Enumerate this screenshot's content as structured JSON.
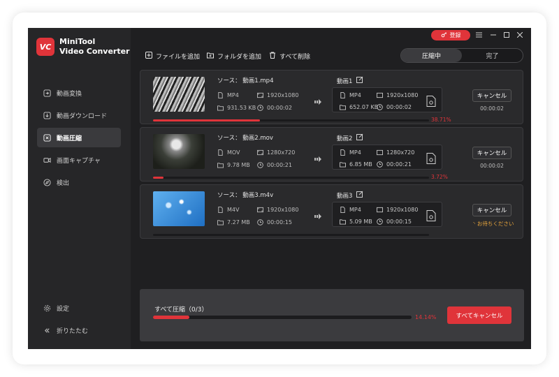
{
  "app": {
    "brand_line1": "MiniTool",
    "brand_line2": "Video Converter",
    "logo_text": "VC"
  },
  "topbar": {
    "login_label": "登録",
    "menu_icon": "hamburger-icon",
    "minimize_icon": "minimize-icon",
    "maximize_icon": "maximize-icon",
    "close_icon": "close-icon"
  },
  "sidebar": {
    "items": [
      {
        "label": "動画変換",
        "icon": "convert-icon",
        "active": false
      },
      {
        "label": "動画ダウンロード",
        "icon": "download-icon",
        "active": false
      },
      {
        "label": "動画圧縮",
        "icon": "compress-icon",
        "active": true
      },
      {
        "label": "画面キャプチャ",
        "icon": "camera-icon",
        "active": false
      },
      {
        "label": "検出",
        "icon": "compass-icon",
        "active": false
      }
    ],
    "settings_label": "設定",
    "collapse_label": "折りたたむ"
  },
  "toolbar": {
    "add_file_label": "ファイルを追加",
    "add_folder_label": "フォルダを追加",
    "delete_all_label": "すべて削除",
    "tabs": [
      "圧縮中",
      "完了"
    ]
  },
  "tasks": [
    {
      "source_label": "ソース：",
      "source_name": "動画1.mp4",
      "src_format": "MP4",
      "src_resolution": "1920x1080",
      "src_size": "931.53 KB",
      "src_duration": "00:00:02",
      "out_name": "動画1",
      "out_format": "MP4",
      "out_resolution": "1920x1080",
      "out_size": "652.07 KB",
      "out_duration": "00:00:02",
      "cancel_label": "キャンセル",
      "elapsed": "00:00:02",
      "progress": 0.3871,
      "progress_label": "38.71%"
    },
    {
      "source_label": "ソース：",
      "source_name": "動画2.mov",
      "src_format": "MOV",
      "src_resolution": "1280x720",
      "src_size": "9.78 MB",
      "src_duration": "00:00:21",
      "out_name": "動画2",
      "out_format": "MP4",
      "out_resolution": "1280x720",
      "out_size": "6.85 MB",
      "out_duration": "00:00:21",
      "cancel_label": "キャンセル",
      "elapsed": "00:00:02",
      "progress": 0.0372,
      "progress_label": "3.72%"
    },
    {
      "source_label": "ソース：",
      "source_name": "動画3.m4v",
      "src_format": "M4V",
      "src_resolution": "1920x1080",
      "src_size": "7.27 MB",
      "src_duration": "00:00:15",
      "out_name": "動画3",
      "out_format": "MP4",
      "out_resolution": "1920x1080",
      "out_size": "5.09 MB",
      "out_duration": "00:00:15",
      "cancel_label": "キャンセル",
      "waiting_label": "お待ちください",
      "progress": 0
    }
  ],
  "summary": {
    "all_label": "すべて圧縮（0/3）",
    "progress": 0.1414,
    "progress_label": "14.14%",
    "cancel_all_label": "すべてキャンセル"
  },
  "colors": {
    "accent": "#e0343a",
    "waiting": "#e8a53c"
  }
}
